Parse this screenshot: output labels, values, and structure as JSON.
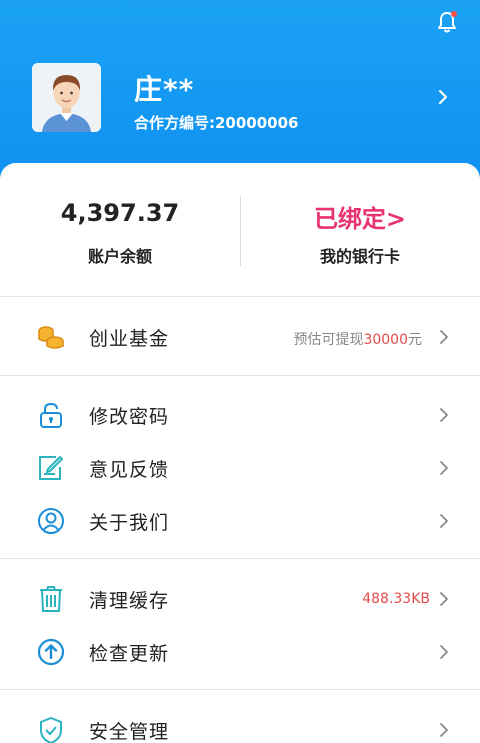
{
  "profile": {
    "name": "庄**",
    "partner_id_label": "合作方编号:",
    "partner_id": "20000006"
  },
  "summary": {
    "balance_value": "4,397.37",
    "balance_label": "账户余额",
    "bank_status": "已绑定>",
    "bank_label": "我的银行卡"
  },
  "menu": {
    "fund": {
      "label": "创业基金",
      "hint_prefix": "预估可提现",
      "hint_amount": "30000",
      "hint_suffix": "元"
    },
    "change_password": {
      "label": "修改密码"
    },
    "feedback": {
      "label": "意见反馈"
    },
    "about": {
      "label": "关于我们"
    },
    "clear_cache": {
      "label": "清理缓存",
      "size": "488.33KB"
    },
    "check_update": {
      "label": "检查更新"
    },
    "security": {
      "label": "安全管理"
    }
  },
  "colors": {
    "header_blue": "#0d8ff0",
    "accent_pink": "#e9336e",
    "accent_red": "#e24b4b",
    "icon_blue": "#1a8fd8",
    "icon_orange": "#f0a020",
    "icon_teal": "#2bb3c0"
  },
  "icons": {
    "bell": "bell-icon",
    "fund": "coins-icon",
    "password": "lock-icon",
    "feedback": "edit-note-icon",
    "about": "user-circle-icon",
    "cache": "trash-icon",
    "update": "arrow-up-circle-icon",
    "security": "shield-icon"
  }
}
